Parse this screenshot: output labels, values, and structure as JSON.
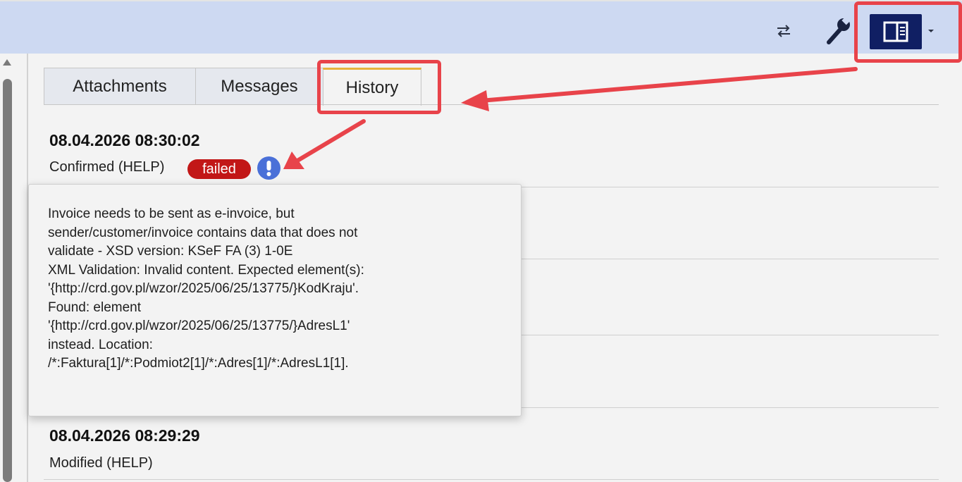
{
  "toolbar": {
    "swap_icon": "swap-arrows-icon",
    "wrench_icon": "wrench-icon",
    "panel_icon": "side-panel-icon",
    "dropdown_icon": "caret-down-icon"
  },
  "tabs": [
    {
      "label": "Attachments",
      "active": false
    },
    {
      "label": "Messages",
      "active": false
    },
    {
      "label": "History",
      "active": true
    }
  ],
  "history": [
    {
      "timestamp": "08.04.2026 08:30:02",
      "status": "Confirmed (HELP)",
      "badge": "failed"
    },
    {
      "timestamp": "08.04.2026 08:29:29",
      "status": "Modified (HELP)"
    }
  ],
  "tooltip": {
    "lines": [
      "Invoice needs to be sent as e-invoice, but",
      "sender/customer/invoice contains data that does not",
      "validate - XSD version: KSeF FA (3) 1-0E",
      "XML Validation: Invalid content. Expected element(s):",
      "'{http://crd.gov.pl/wzor/2025/06/25/13775/}KodKraju'.",
      "Found: element",
      "'{http://crd.gov.pl/wzor/2025/06/25/13775/}AdresL1'",
      "instead. Location:",
      "/*:Faktura[1]/*:Podmiot2[1]/*:Adres[1]/*:AdresL1[1]."
    ]
  },
  "colors": {
    "toolbar_bg": "#cdd9f2",
    "active_button_bg": "#101f63",
    "badge_failed": "#c21717",
    "info_icon": "#4a70d8",
    "annotation": "#e8434a",
    "active_tab_accent": "#e7b23d"
  }
}
